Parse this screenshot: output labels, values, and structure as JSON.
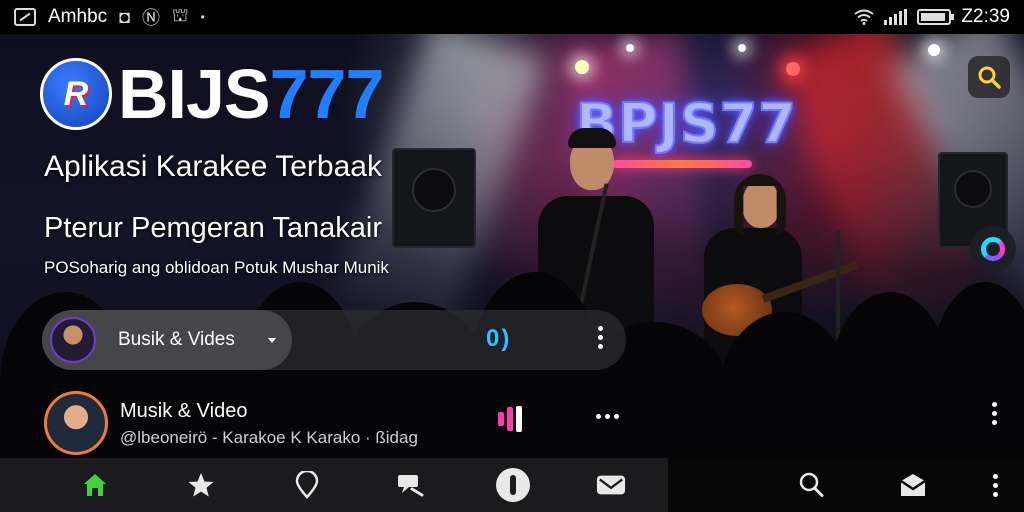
{
  "statusbar": {
    "carrier": "Amhbc",
    "time": "Z2:39",
    "icons": [
      "screenshot-icon",
      "notification-icon",
      "nfc-icon",
      "lock-icon",
      "wifi-icon",
      "signal-icon",
      "battery-icon"
    ]
  },
  "hero": {
    "logo_part1": "BIJS",
    "logo_part2": "777",
    "neon_sign": "BPJS77",
    "headline": "Aplikasi Karakee Terbaak",
    "subhead": "Pterur Pemgeran Tanakair",
    "tagline": "POSoharig ang oblidoan Potuk Mushar Munik"
  },
  "player": {
    "title": "Busik & Vides",
    "play_glyph": "0)"
  },
  "now_playing": {
    "title": "Musik & Video",
    "meta": "@lbeoneirö - Karakoe    K Karako   · ßidag"
  },
  "colors": {
    "brand_blue": "#1f7fff",
    "accent_cyan": "#2fc0ff",
    "nav_active": "#3fd43f",
    "nav_inactive": "#e8e8e8",
    "eq_pink": "#ff3bb4"
  },
  "bottom_nav": {
    "items": [
      "home-icon",
      "star-icon",
      "location-pin-icon",
      "chat-icon",
      "circle-button-icon",
      "mail-icon",
      "search-icon",
      "mail-open-icon",
      "more-vertical-icon"
    ],
    "active": "home-icon"
  }
}
